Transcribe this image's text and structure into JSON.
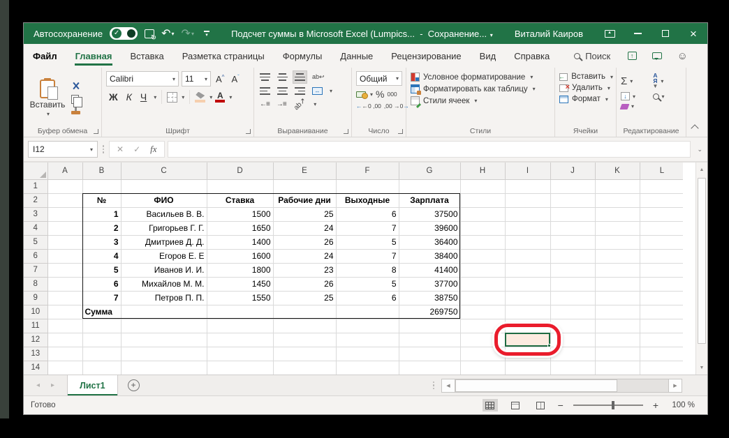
{
  "titlebar": {
    "autosave_label": "Автосохранение",
    "title": "Подсчет суммы в Microsoft Excel (Lumpics...",
    "separator": "-",
    "saving": "Сохранение...",
    "user": "Виталий Каиров"
  },
  "tabs": [
    {
      "label": "Файл"
    },
    {
      "label": "Главная",
      "active": true
    },
    {
      "label": "Вставка"
    },
    {
      "label": "Разметка страницы"
    },
    {
      "label": "Формулы"
    },
    {
      "label": "Данные"
    },
    {
      "label": "Рецензирование"
    },
    {
      "label": "Вид"
    },
    {
      "label": "Справка"
    }
  ],
  "search": {
    "label": "Поиск"
  },
  "ribbon": {
    "clipboard": {
      "paste_label": "Вставить",
      "label": "Буфер обмена"
    },
    "font": {
      "family": "Calibri",
      "size": "11",
      "bold": "Ж",
      "italic": "К",
      "underline": "Ч",
      "letter": "А",
      "label": "Шрифт"
    },
    "alignment": {
      "label": "Выравнивание",
      "wrap_glyph": "ab",
      "orient_glyph": "ab"
    },
    "number": {
      "format": "Общий",
      "percent": "%",
      "zeros": "000",
      "dec_inc": "←0 ,00",
      "dec_dec": ",00 →0",
      "label": "Число"
    },
    "styles": {
      "conditional": "Условное форматирование",
      "as_table": "Форматировать как таблицу",
      "cell_styles": "Стили ячеек",
      "label": "Стили"
    },
    "cells": {
      "insert": "Вставить",
      "delete": "Удалить",
      "format": "Формат",
      "label": "Ячейки"
    },
    "editing": {
      "autosum_glyph": "Σ",
      "sort_glyph_top": "А",
      "sort_glyph_bottom": "Я",
      "label": "Редактирование"
    }
  },
  "formula_bar": {
    "name_box": "I12",
    "fx": "fx"
  },
  "grid": {
    "columns": [
      "A",
      "B",
      "C",
      "D",
      "E",
      "F",
      "G",
      "H",
      "I",
      "J",
      "K",
      "L"
    ],
    "row_numbers": [
      1,
      2,
      3,
      4,
      5,
      6,
      7,
      8,
      9,
      10,
      11,
      12,
      13,
      14
    ],
    "selection": "I12",
    "highlight_column": "I",
    "highlight_row": 12,
    "table": {
      "start_cell": "B2",
      "headers": [
        "№",
        "ФИО",
        "Ставка",
        "Рабочие дни",
        "Выходные",
        "Зарплата"
      ],
      "rows": [
        [
          1,
          "Васильев В. В.",
          1500,
          25,
          6,
          37500
        ],
        [
          2,
          "Григорьев Г. Г.",
          1650,
          24,
          7,
          39600
        ],
        [
          3,
          "Дмитриев Д. Д.",
          1400,
          26,
          5,
          36400
        ],
        [
          4,
          "Егоров Е. Е",
          1600,
          24,
          7,
          38400
        ],
        [
          5,
          "Иванов И. И.",
          1800,
          23,
          8,
          41400
        ],
        [
          6,
          "Михайлов М. М.",
          1450,
          26,
          5,
          37700
        ],
        [
          7,
          "Петров П. П.",
          1550,
          25,
          6,
          38750
        ]
      ],
      "sum_label": "Сумма",
      "total": 269750
    }
  },
  "sheet_bar": {
    "tab_name": "Лист1"
  },
  "status_bar": {
    "ready": "Готово",
    "zoom": "100 %"
  },
  "colors": {
    "excel_green": "#217346",
    "table_fill": "#8ea9db",
    "annotation_red": "#ea1c2c",
    "selection_fill": "#fcebe0",
    "font_color_bar": "#c00000"
  }
}
